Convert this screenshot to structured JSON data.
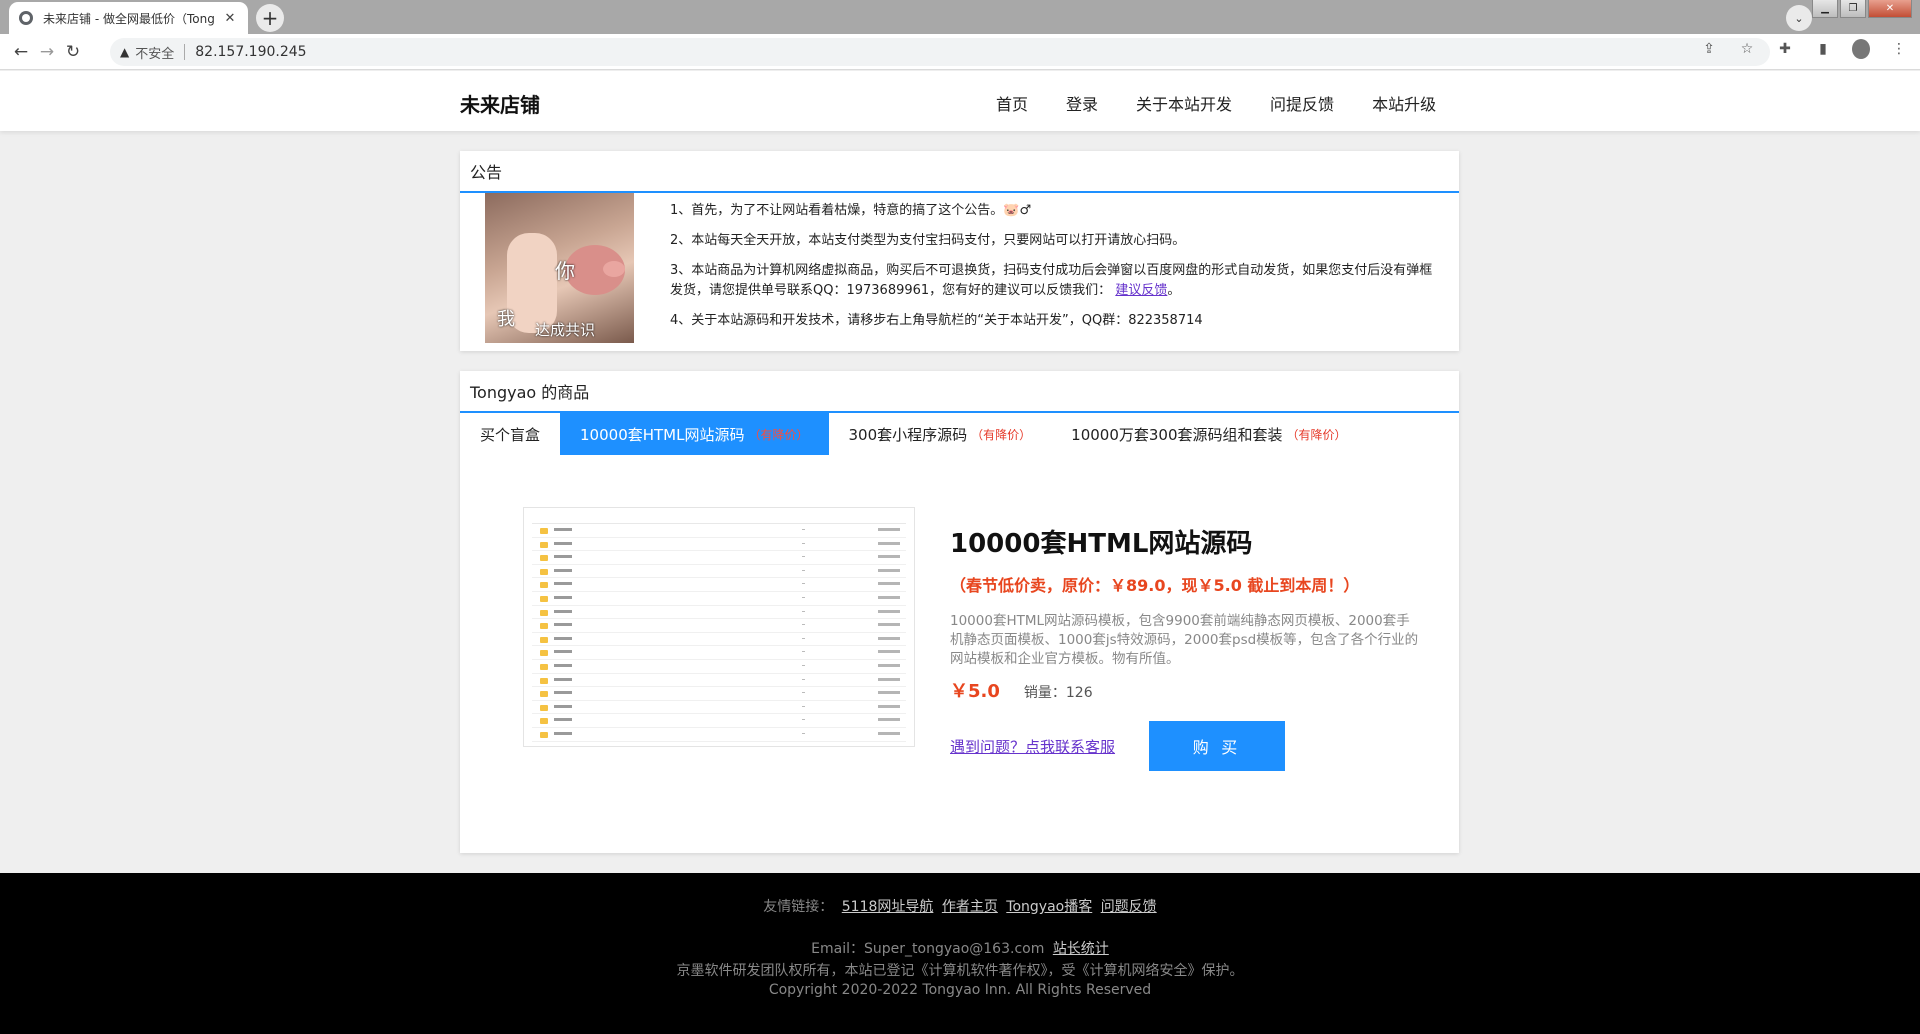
{
  "browser": {
    "tab_title": "未来店铺 - 做全网最低价（Tong",
    "tab_close": "✕",
    "new_tab": "+",
    "security_label": "不安全",
    "url": "82.157.190.245"
  },
  "header": {
    "brand": "未来店铺",
    "nav": [
      "首页",
      "登录",
      "关于本站开发",
      "问提反馈",
      "本站升级"
    ]
  },
  "notice": {
    "title": "公告",
    "image_captions": [
      "你",
      "我",
      "达成共识"
    ],
    "items": [
      "1、首先，为了不让网站看着枯燥，特意的搞了这个公告。🐷♂",
      "2、本站每天全天开放，本站支付类型为支付宝扫码支付，只要网站可以打开请放心扫码。",
      "3、本站商品为计算机网络虚拟商品，购买后不可退换货，扫码支付成功后会弹窗以百度网盘的形式自动发货，如果您支付后没有弹框发货，请您提供单号联系QQ：1973689961，您有好的建议可以反馈我们：",
      "4、关于本站源码和开发技术，请移步右上角导航栏的“关于本站开发”，QQ群：822358714"
    ],
    "feedback_link": "建议反馈",
    "feedback_suffix": "。"
  },
  "goods": {
    "title": "Tongyao 的商品",
    "tabs": [
      {
        "label": "买个盲盒",
        "badge": ""
      },
      {
        "label": "10000套HTML网站源码",
        "badge": "（有降价）"
      },
      {
        "label": "300套小程序源码",
        "badge": "（有降价）"
      },
      {
        "label": "10000万套300套源码组和套装",
        "badge": "（有降价）"
      }
    ],
    "active_tab": 1,
    "product": {
      "title": "10000套HTML网站源码",
      "promo": "（春节低价卖，原价：￥89.0，现￥5.0 截止到本周！）",
      "description": "10000套HTML网站源码模板，包含9900套前端纯静态网页模板、2000套手机静态页面模板、1000套js特效源码，2000套psd模板等，包含了各个行业的网站模板和企业官方模板。物有所值。",
      "price": "￥5.0",
      "sales": "销量：126",
      "help_link": "遇到问题？点我联系客服",
      "buy_label": "购 买"
    }
  },
  "footer": {
    "links_label": "友情链接：",
    "links": [
      "5118网址导航",
      "作者主页",
      "Tongyao播客",
      "问题反馈"
    ],
    "email": "Email：Super_tongyao@163.com",
    "stats_link": "站长统计",
    "rights": "京墨软件研发团队权所有，本站已登记《计算机软件著作权》，受《计算机网络安全》保护。",
    "copyright": "Copyright 2020-2022 Tongyao Inn. All Rights Reserved"
  },
  "colors": {
    "accent": "#1e90ff",
    "promo": "#e8461f",
    "link": "#6633cc"
  }
}
